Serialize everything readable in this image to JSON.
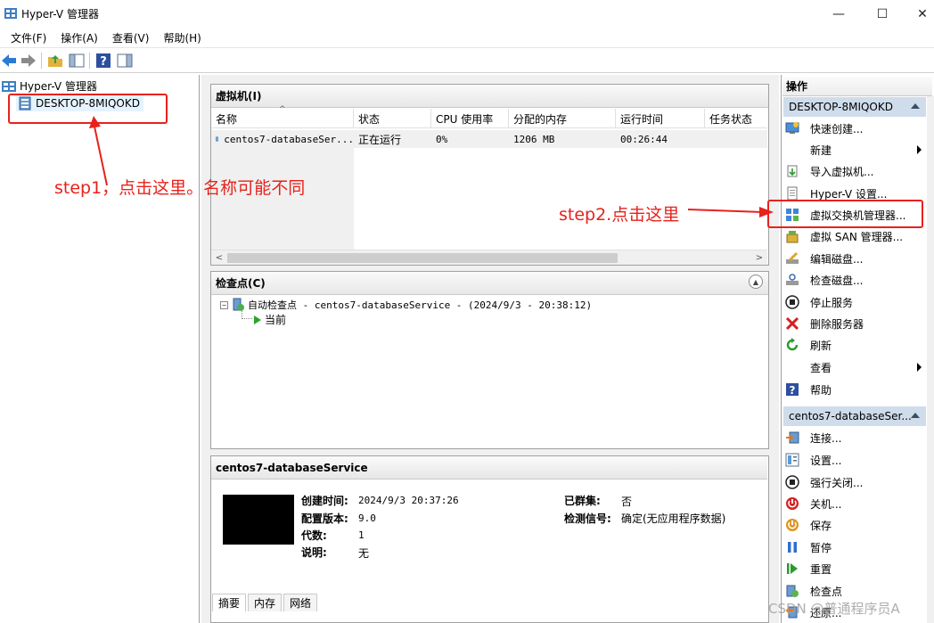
{
  "window": {
    "title": "Hyper-V 管理器",
    "minimize": "—",
    "maximize": "☐",
    "close": "✕"
  },
  "menu": [
    "文件(F)",
    "操作(A)",
    "查看(V)",
    "帮助(H)"
  ],
  "tree": {
    "root": "Hyper-V 管理器",
    "server": "DESKTOP-8MIQOKD"
  },
  "vms": {
    "header": "虚拟机(I)",
    "columns": [
      "名称",
      "状态",
      "CPU 使用率",
      "分配的内存",
      "运行时间",
      "任务状态"
    ],
    "rows": [
      {
        "name": "centos7-databaseSer...",
        "state": "正在运行",
        "cpu": "0%",
        "memory": "1206 MB",
        "uptime": "00:26:44",
        "task": ""
      }
    ]
  },
  "checkpoints": {
    "header": "检查点(C)",
    "auto": "自动检查点 - centos7-databaseService - (2024/9/3 - 20:38:12)",
    "now": "当前"
  },
  "details": {
    "title": "centos7-databaseService",
    "created_label": "创建时间:",
    "created_value": "2024/9/3 20:37:26",
    "config_label": "配置版本:",
    "config_value": "9.0",
    "gen_label": "代数:",
    "gen_value": "1",
    "notes_label": "说明:",
    "notes_value": "无",
    "cluster_label": "已群集:",
    "cluster_value": "否",
    "heartbeat_label": "检测信号:",
    "heartbeat_value": "确定(无应用程序数据)",
    "tabs": [
      "摘要",
      "内存",
      "网络"
    ]
  },
  "actions": {
    "title": "操作",
    "server_group": "DESKTOP-8MIQOKD",
    "server_items": [
      {
        "label": "快速创建...",
        "icon": "quick-create-icon"
      },
      {
        "label": "新建",
        "icon": "new-icon",
        "submenu": true
      },
      {
        "label": "导入虚拟机...",
        "icon": "import-icon"
      },
      {
        "label": "Hyper-V 设置...",
        "icon": "settings-doc-icon"
      },
      {
        "label": "虚拟交换机管理器...",
        "icon": "switch-manager-icon"
      },
      {
        "label": "虚拟 SAN 管理器...",
        "icon": "san-icon"
      },
      {
        "label": "编辑磁盘...",
        "icon": "edit-disk-icon"
      },
      {
        "label": "检查磁盘...",
        "icon": "inspect-disk-icon"
      },
      {
        "label": "停止服务",
        "icon": "stop-service-icon"
      },
      {
        "label": "删除服务器",
        "icon": "remove-icon"
      },
      {
        "label": "刷新",
        "icon": "refresh-icon"
      },
      {
        "label": "查看",
        "icon": "view-icon",
        "submenu": true
      },
      {
        "label": "帮助",
        "icon": "help-icon"
      }
    ],
    "vm_group": "centos7-databaseSer...",
    "vm_items": [
      {
        "label": "连接...",
        "icon": "connect-icon"
      },
      {
        "label": "设置...",
        "icon": "vm-settings-icon"
      },
      {
        "label": "强行关闭...",
        "icon": "turn-off-icon"
      },
      {
        "label": "关机...",
        "icon": "shutdown-icon"
      },
      {
        "label": "保存",
        "icon": "save-icon"
      },
      {
        "label": "暂停",
        "icon": "pause-icon"
      },
      {
        "label": "重置",
        "icon": "reset-icon"
      },
      {
        "label": "检查点",
        "icon": "checkpoint-icon"
      },
      {
        "label": "还原...",
        "icon": "revert-icon"
      }
    ]
  },
  "annotations": {
    "step1": "step1，点击这里。名称可能不同",
    "step2": "step2.点击这里",
    "color": "#e8211b"
  },
  "watermark": "CSDN @普通程序员A"
}
